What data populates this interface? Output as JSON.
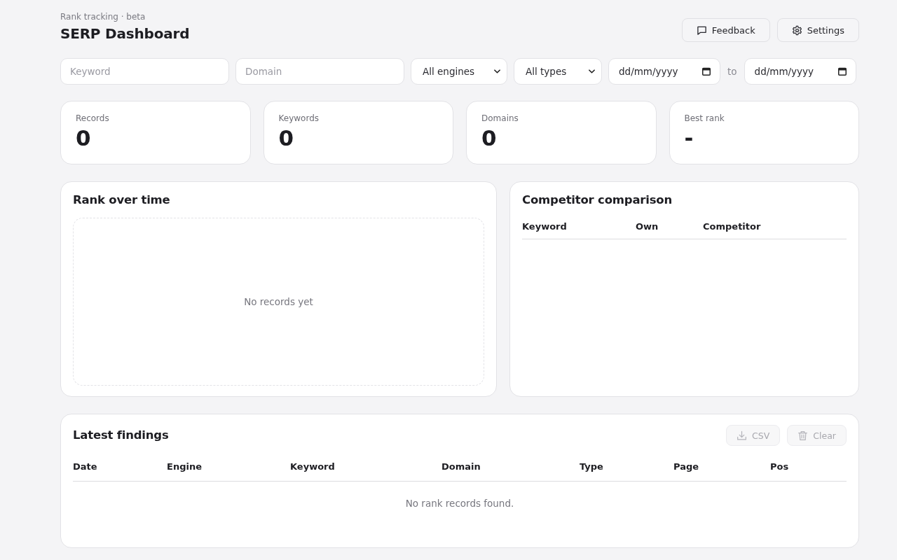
{
  "header": {
    "subtitle": "Rank tracking · beta",
    "title": "SERP Dashboard",
    "buttons": [
      {
        "label": "Feedback"
      },
      {
        "label": "Settings"
      }
    ]
  },
  "filters": {
    "keyword": {
      "placeholder": "Keyword"
    },
    "domain": {
      "placeholder": "Domain"
    },
    "engine": {
      "value": "All engines"
    },
    "type": {
      "value": "All types"
    },
    "date_from": {
      "placeholder": "dd/mm/yyyy"
    },
    "range_separator": "to",
    "date_to": {
      "placeholder": "dd/mm/yyyy"
    }
  },
  "stats": [
    {
      "label": "Records",
      "value": "0"
    },
    {
      "label": "Keywords",
      "value": "0"
    },
    {
      "label": "Domains",
      "value": "0"
    },
    {
      "label": "Best rank",
      "value": "-"
    }
  ],
  "rank_over_time": {
    "title": "Rank over time",
    "empty_message": "No records yet"
  },
  "competitor_comparison": {
    "title": "Competitor comparison",
    "columns": [
      "Keyword",
      "Own",
      "Competitor"
    ]
  },
  "latest_findings": {
    "title": "Latest findings",
    "actions": [
      {
        "label": "CSV",
        "disabled": true
      },
      {
        "label": "Clear",
        "disabled": true
      }
    ],
    "columns": [
      "Date",
      "Engine",
      "Keyword",
      "Domain",
      "Type",
      "Page",
      "Pos"
    ],
    "empty_message": "No rank records found."
  }
}
